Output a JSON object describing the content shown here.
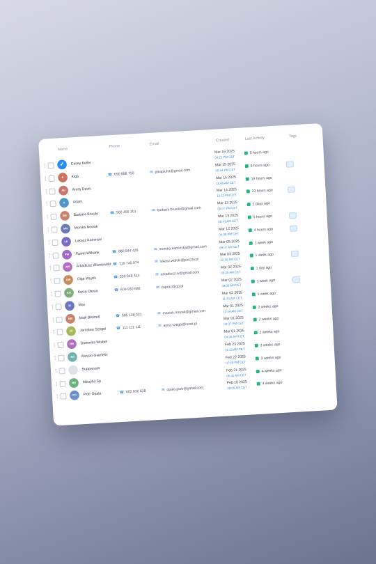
{
  "headers": {
    "name": "Name",
    "phone": "Phone",
    "email": "Email",
    "created": "Created",
    "last_activity": "Last Activity",
    "tags": "Tags"
  },
  "rows": [
    {
      "initials": "",
      "name": "Casey Keller",
      "phone": "",
      "email": "",
      "created_date": "Mar 16 2025",
      "created_time": "04:21 PM CET",
      "last": "5 hours ago",
      "tag": false,
      "color": "#2d8cf0",
      "selected": true
    },
    {
      "initials": "K",
      "name": "Kiga",
      "phone": "690 888 750",
      "email": "pikapiuha@gmail.com",
      "created_date": "Mar 15 2025",
      "created_time": "05:54 PM CET",
      "last": "6 hours ago",
      "tag": true,
      "color": "#c7735f"
    },
    {
      "initials": "AD",
      "name": "Amity Davis",
      "phone": "",
      "email": "",
      "created_date": "Mar 15 2025",
      "created_time": "11:06 AM CET",
      "last": "19 hours ago",
      "tag": false,
      "color": "#c9746d"
    },
    {
      "initials": "A",
      "name": "Adam",
      "phone": "",
      "email": "",
      "created_date": "Mar 14 2025",
      "created_time": "12:11 PM CET",
      "last": "23 hours ago",
      "tag": true,
      "color": "#4e96c9"
    },
    {
      "initials": "BB",
      "name": "Barbara Brusilo",
      "phone": "500 456 301",
      "email": "barbara.brusilo@gmail.com",
      "created_date": "Mar 13 2025",
      "created_time": "05:07 PM CET",
      "last": "2 days ago",
      "tag": false,
      "color": "#c9836a"
    },
    {
      "initials": "MN",
      "name": "Monika Nowak",
      "phone": "",
      "email": "",
      "created_date": "Mar 13 2025",
      "created_time": "08:41 AM CET",
      "last": "5 hours ago",
      "tag": true,
      "color": "#6a78b5"
    },
    {
      "initials": "LK",
      "name": "Lukasz Kaminski",
      "phone": "",
      "email": "",
      "created_date": "Mar 12 2025",
      "created_time": "05:38 PM CET",
      "last": "4 hours ago",
      "tag": true,
      "color": "#7b6bc4"
    },
    {
      "initials": "PW",
      "name": "Pawel Wilbank",
      "phone": "880 844 429",
      "email": "monika.kaminska@gmail.com",
      "created_date": "Mar 05 2025",
      "created_time": "09:07 AM CET",
      "last": "1 week ago",
      "tag": false,
      "color": "#a267c7"
    },
    {
      "initials": "AW",
      "name": "Arkadiusz Wisniewski",
      "phone": "719 740 974",
      "email": "lukasz.wolski@poczta.pl",
      "created_date": "Mar 03 2025",
      "created_time": "12:18 AM CET",
      "last": "1 week ago",
      "tag": true,
      "color": "#b470c4"
    },
    {
      "initials": "OW",
      "name": "Olga Wojcik",
      "phone": "530 948 414",
      "email": "arkadiusz.w@gmail.com",
      "created_date": "Mar 02 2025",
      "created_time": "06:25 AM CET",
      "last": "1 day ago",
      "tag": false,
      "color": "#c98a5e"
    },
    {
      "initials": "KO",
      "name": "Kasia Olesia",
      "phone": "609 930 686",
      "email": "zapraz@op.pl",
      "created_date": "Mar 02 2025",
      "created_time": "09:09 AM CET",
      "last": "1 week ago",
      "tag": true,
      "color": "#7fae7b"
    },
    {
      "initials": "M",
      "name": "Max",
      "phone": "",
      "email": "",
      "created_date": "Mar 02 2025",
      "created_time": "11:44 AM CET",
      "last": "1 week ago",
      "tag": false,
      "color": "#6c75c2"
    },
    {
      "initials": "MB",
      "name": "Maik Bennett",
      "phone": "505 128 031",
      "email": "maciek.roszak@gmail.com",
      "created_date": "Mar 01 2025",
      "created_time": "12:44 AM CET",
      "last": "2 weeks ago",
      "tag": false,
      "color": "#c9826a"
    },
    {
      "initials": "JS",
      "name": "Jaroslaw Szegol",
      "phone": "111 111 111",
      "email": "anna.szegol@onet.pl",
      "created_date": "Mar 01 2025",
      "created_time": "04:37 PM CET",
      "last": "2 weeks ago",
      "tag": false,
      "color": "#a7bb55"
    },
    {
      "initials": "DW",
      "name": "Dominika Wisbet",
      "phone": "",
      "email": "",
      "created_date": "Mar 01 2025",
      "created_time": "04:36 AM CET",
      "last": "2 weeks ago",
      "tag": false,
      "color": "#b06fbf"
    },
    {
      "initials": "AG",
      "name": "Alessio Gianfelix",
      "phone": "",
      "email": "",
      "created_date": "Feb 23 2025",
      "created_time": "11:13 AM CET",
      "last": "3 weeks ago",
      "tag": false,
      "color": "#6fb3b1"
    },
    {
      "initials": "",
      "name": "Suppresser",
      "phone": "",
      "email": "",
      "created_date": "Feb 22 2025",
      "created_time": "07:59 PM CET",
      "last": "3 weeks ago",
      "tag": false,
      "color": "#dfe2ea"
    },
    {
      "initials": "MS",
      "name": "Mikaylia Sp",
      "phone": "",
      "email": "",
      "created_date": "Feb 21 2025",
      "created_time": "06:40 AM CET",
      "last": "4 weeks ago",
      "tag": false,
      "color": "#6cb27e"
    },
    {
      "initials": "PO",
      "name": "Piotr Opala",
      "phone": "602 930 628",
      "email": "opala.piotr@gmail.com",
      "created_date": "Feb 16 2025",
      "created_time": "08:09 AM CET",
      "last": "4 weeks ago",
      "tag": false,
      "color": "#6a8fc9"
    }
  ]
}
